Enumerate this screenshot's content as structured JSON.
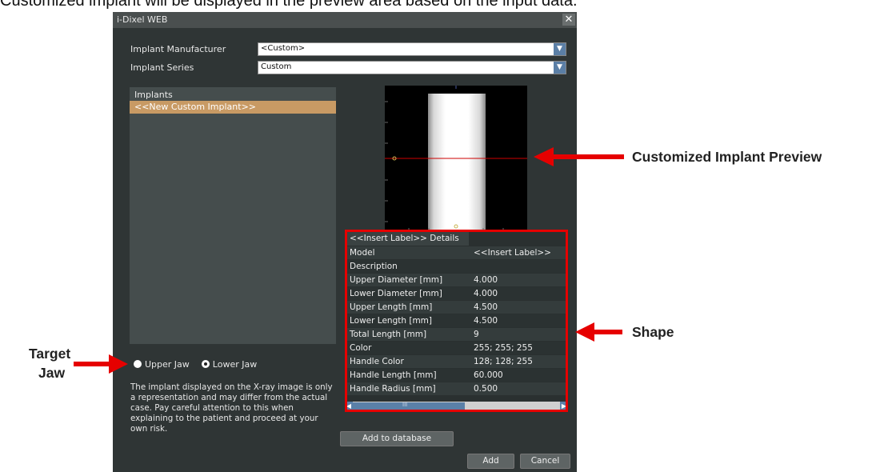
{
  "caption": "Customized implant will be displayed in the preview area based on the input data.",
  "window": {
    "title": "i-Dixel WEB",
    "close_glyph": "✕"
  },
  "form": {
    "manufacturer_label": "Implant Manufacturer",
    "manufacturer_value": "<Custom>",
    "series_label": "Implant Series",
    "series_value": "Custom"
  },
  "implants": {
    "header": "Implants",
    "items": [
      "<<New Custom Implant>>"
    ]
  },
  "jaw": {
    "upper_label": "Upper Jaw",
    "lower_label": "Lower Jaw",
    "selected": "Lower Jaw"
  },
  "warning_text": "The implant displayed on the X-ray image is only a representation and may differ from the actual case. Pay careful attention to this when explaining to the patient and proceed at your own risk.",
  "details": {
    "tab_label": "<<Insert Label>> Details",
    "rows": [
      {
        "key": "Model",
        "value": "<<Insert Label>>"
      },
      {
        "key": "Description",
        "value": ""
      },
      {
        "key": "Upper Diameter [mm]",
        "value": "4.000"
      },
      {
        "key": "Lower Diameter [mm]",
        "value": "4.000"
      },
      {
        "key": "Upper Length [mm]",
        "value": "4.500"
      },
      {
        "key": "Lower Length [mm]",
        "value": "4.500"
      },
      {
        "key": "Total Length [mm]",
        "value": "9"
      },
      {
        "key": "Color",
        "value": "255; 255; 255"
      },
      {
        "key": "Handle Color",
        "value": "128; 128; 255"
      },
      {
        "key": "Handle Length [mm]",
        "value": "60.000"
      },
      {
        "key": "Handle Radius [mm]",
        "value": "0.500"
      }
    ],
    "scroll_thumb_glyph": "III"
  },
  "buttons": {
    "add_to_database": "Add to database",
    "add": "Add",
    "cancel": "Cancel"
  },
  "annotations": {
    "preview": "Customized Implant Preview",
    "shape": "Shape",
    "target_jaw_line1": "Target",
    "target_jaw_line2": "Jaw"
  },
  "colors": {
    "annotation_red": "#e60000",
    "selection": "#c89a64",
    "window_bg": "#2f3535"
  }
}
